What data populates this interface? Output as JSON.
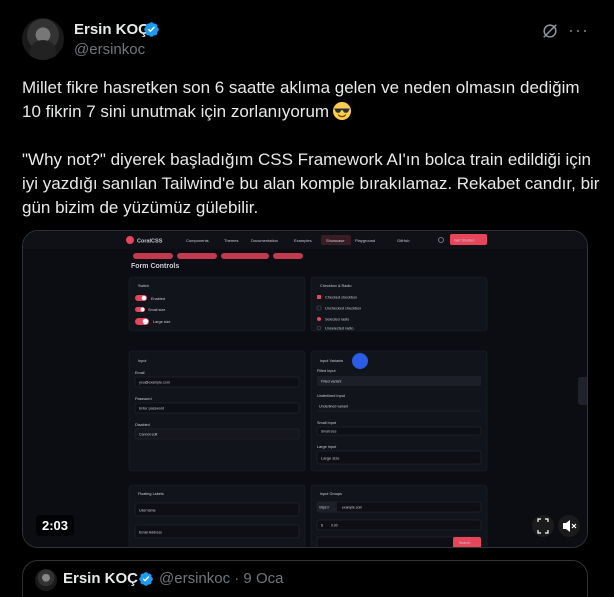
{
  "author": {
    "name": "Ersin KOÇ",
    "handle": "@ersinkoc"
  },
  "tweet": {
    "paragraph1": "Millet fikre hasretken son 6 saatte aklıma gelen ve neden olmasın dediğim 10 fikrin 7 sini unutmak için zorlanıyorum",
    "paragraph2": "\"Why not?\" diyerek başladığım CSS Framework AI'ın bolca train edildiği için iyi yazdığı sanılan Tailwind'e bu alan komple bırakılamaz. Rekabet candır, bir gün bizim de yüzümüz gülebilir."
  },
  "video": {
    "duration": "2:03"
  },
  "app_screenshot": {
    "logo": "CoralCSS",
    "nav": [
      "Components",
      "Themes",
      "Documentation",
      "Examples",
      "Showcase",
      "Playground",
      "GitHub"
    ],
    "cta": "Get Started",
    "section_title": "Form Controls",
    "switch_panel": {
      "title": "Switch",
      "items": [
        "Enabled",
        "Small size",
        "Large size"
      ]
    },
    "checkbox_panel": {
      "title": "Checkbox & Radio",
      "items": [
        "Checked checkbox",
        "Unchecked checkbox",
        "Selected radio",
        "Unselected radio"
      ]
    },
    "input_panel": {
      "title": "Input",
      "fields": [
        {
          "label": "Email",
          "value": "you@example.com"
        },
        {
          "label": "Password",
          "value": "Enter password"
        },
        {
          "label": "Disabled",
          "value": "Cannot edit"
        }
      ]
    },
    "variants_panel": {
      "title": "Input Variants",
      "fields": [
        {
          "label": "Filled Input",
          "value": "Filled variant"
        },
        {
          "label": "Underlined Input",
          "value": "Underlined variant"
        },
        {
          "label": "Small Input",
          "value": "Small size"
        },
        {
          "label": "Large Input",
          "value": "Large size"
        }
      ]
    },
    "floating_panel": {
      "title": "Floating Labels",
      "fields": [
        "Username",
        "Email Address"
      ]
    },
    "groups_panel": {
      "title": "Input Groups",
      "prefix": "https://",
      "url": "example.com",
      "amount": "0.00",
      "search_button": "Search"
    }
  },
  "quote": {
    "name": "Ersin KOÇ",
    "handle": "@ersinkoc",
    "date": "· 9 Oca"
  },
  "colors": {
    "accent": "#1d9bf0",
    "coral": "#e6455a",
    "muted": "#71767b",
    "border": "#2f3336"
  }
}
